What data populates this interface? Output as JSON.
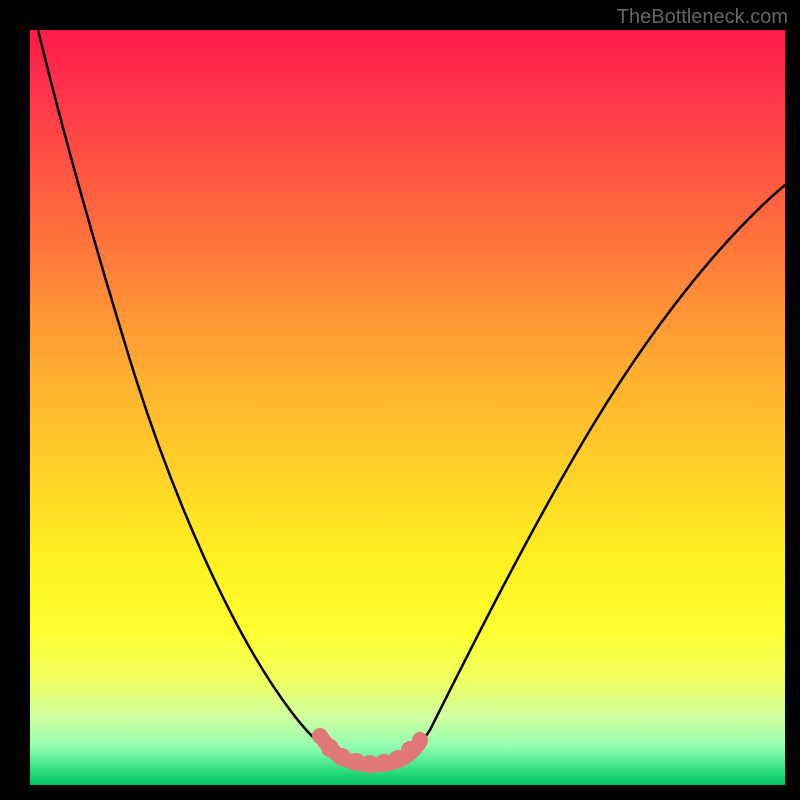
{
  "watermark": "TheBottleneck.com",
  "chart_data": {
    "type": "line",
    "title": "",
    "xlabel": "",
    "ylabel": "",
    "xlim": [
      0,
      100
    ],
    "ylim": [
      0,
      100
    ],
    "series": [
      {
        "name": "bottleneck-curve",
        "x": [
          0,
          5,
          10,
          15,
          20,
          25,
          30,
          35,
          38,
          40,
          42,
          44,
          46,
          48,
          50,
          55,
          60,
          65,
          70,
          75,
          80,
          85,
          90,
          95,
          100
        ],
        "y": [
          100,
          90,
          79,
          68,
          56,
          44,
          32,
          20,
          12,
          7,
          3,
          1,
          1,
          1,
          3,
          9,
          17,
          25,
          33,
          40,
          47,
          53,
          59,
          64,
          68
        ]
      }
    ],
    "markers": {
      "name": "optimal-zone",
      "x": [
        38,
        40,
        42,
        44,
        46,
        48,
        50
      ],
      "y": [
        8,
        4,
        2,
        1,
        1,
        2,
        4
      ]
    },
    "gradient_colors": {
      "top": "#ff1a4a",
      "upper_mid": "#ff8838",
      "mid": "#ffff30",
      "lower_mid": "#d0ffa0",
      "bottom": "#00c060"
    }
  }
}
